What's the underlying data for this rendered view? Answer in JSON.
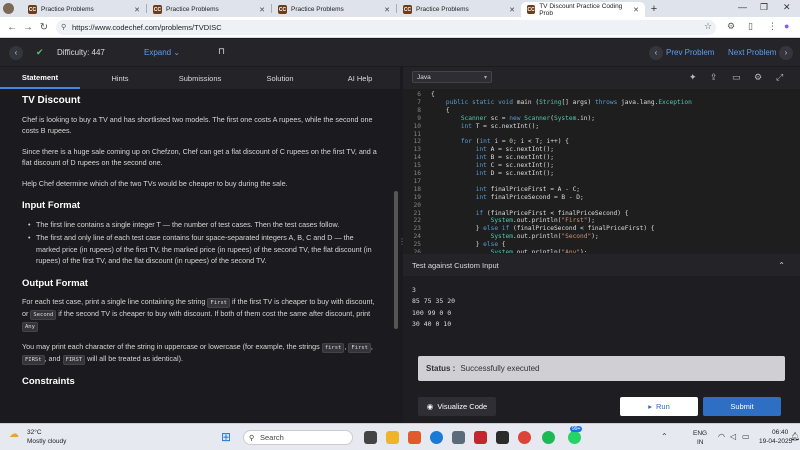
{
  "browser": {
    "tabs": [
      {
        "label": "Practice Problems",
        "favicon": "CC"
      },
      {
        "label": "Practice Problems",
        "favicon": "CC"
      },
      {
        "label": "Practice Problems",
        "favicon": "CC"
      },
      {
        "label": "Practice Problems",
        "favicon": "CC"
      },
      {
        "label": "TV Discount Practice Coding Prob",
        "favicon": "CC"
      }
    ],
    "url": "https://www.codechef.com/problems/TVDISC"
  },
  "topbar": {
    "difficulty": "Difficulty: 447",
    "expand": "Expand",
    "prev": "Prev Problem",
    "next": "Next Problem"
  },
  "left_tabs": [
    "Statement",
    "Hints",
    "Submissions",
    "Solution",
    "AI Help"
  ],
  "statement": {
    "title": "TV Discount",
    "p1": "Chef is looking to buy a TV and has shortlisted two models. The first one costs A rupees, while the second one costs B rupees.",
    "p2": "Since there is a huge sale coming up on Chefzon, Chef can get a flat discount of C rupees on the first TV, and a flat discount of D rupees on the second one.",
    "p3": "Help Chef determine which of the two TVs would be cheaper to buy during the sale.",
    "input_heading": "Input Format",
    "input_items": [
      "The first line contains a single integer T — the number of test cases. Then the test cases follow.",
      "The first and only line of each test case contains four space-separated integers A, B, C and D — the marked price (in rupees) of the first TV, the marked price (in rupees) of the second TV, the flat discount (in rupees) of the first TV, and the flat discount (in rupees) of the second TV."
    ],
    "output_heading": "Output Format",
    "out_p1_a": "For each test case, print a single line containing the string",
    "out_first": "First",
    "out_p1_b": "if the first TV is cheaper to buy with discount, or",
    "out_second": "Second",
    "out_p1_c": "if the second TV is cheaper to buy with discount. If both of them cost the same after discount, print",
    "out_any": "Any",
    "out_p2_a": "You may print each character of the string in uppercase or lowercase (for example, the strings",
    "out_p2_s1": "first",
    "out_p2_s2": "First",
    "out_p2_s3": "FIRSt",
    "out_p2_and": ", and",
    "out_p2_s4": "FIRST",
    "out_p2_b": "will all be treated as identical).",
    "constraints_heading": "Constraints"
  },
  "editor": {
    "language": "Java",
    "lines": [
      {
        "n": "6",
        "t": "{"
      },
      {
        "n": "7",
        "t": "    public static void main (String[] args) throws java.lang.Exception"
      },
      {
        "n": "8",
        "t": "    {"
      },
      {
        "n": "9",
        "t": "        Scanner sc = new Scanner(System.in);"
      },
      {
        "n": "10",
        "t": "        int T = sc.nextInt();"
      },
      {
        "n": "11",
        "t": ""
      },
      {
        "n": "12",
        "t": "        for (int i = 0; i < T; i++) {"
      },
      {
        "n": "13",
        "t": "            int A = sc.nextInt();"
      },
      {
        "n": "14",
        "t": "            int B = sc.nextInt();"
      },
      {
        "n": "15",
        "t": "            int C = sc.nextInt();"
      },
      {
        "n": "16",
        "t": "            int D = sc.nextInt();"
      },
      {
        "n": "17",
        "t": ""
      },
      {
        "n": "18",
        "t": "            int finalPriceFirst = A - C;"
      },
      {
        "n": "19",
        "t": "            int finalPriceSecond = B - D;"
      },
      {
        "n": "20",
        "t": ""
      },
      {
        "n": "21",
        "t": "            if (finalPriceFirst < finalPriceSecond) {"
      },
      {
        "n": "22",
        "t": "                System.out.println(\"First\");"
      },
      {
        "n": "23",
        "t": "            } else if (finalPriceSecond < finalPriceFirst) {"
      },
      {
        "n": "24",
        "t": "                System.out.println(\"Second\");"
      },
      {
        "n": "25",
        "t": "            } else {"
      },
      {
        "n": "26",
        "t": "                System.out.println(\"Any\");"
      }
    ]
  },
  "custom_input": {
    "title": "Test against Custom Input",
    "lines": [
      "3",
      "85 75 35 20",
      "100 99 0 0",
      "30 40 0 10"
    ]
  },
  "status": {
    "label": "Status :",
    "value": "Successfully executed"
  },
  "buttons": {
    "visualize": "Visualize Code",
    "run": "Run",
    "submit": "Submit"
  },
  "taskbar": {
    "weather_temp": "32°C",
    "weather_desc": "Mostly cloudy",
    "search": "Search",
    "lang": "ENG",
    "region": "IN",
    "time": "06:40",
    "date": "19-04-2025",
    "badge": "99+"
  },
  "colors": {
    "accent": "#3c8ce7",
    "submit": "#2e6fc4",
    "bg": "#1b1b1f"
  }
}
